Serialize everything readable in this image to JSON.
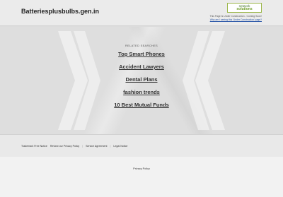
{
  "header": {
    "domain": "Batteriesplusbulbs.gen.in",
    "logo_line1": "network",
    "logo_line2": "solutions",
    "note_line1": "This Page Is Under Construction - Coming Soon!",
    "note_link": "Why am I seeing this 'Under Construction' page?"
  },
  "main": {
    "related_label": "RELATED SEARCHES",
    "links": [
      "Top Smart Phones",
      "Accident Lawyers",
      "Dental Plans",
      "fashion trends",
      "10 Best Mutual Funds"
    ]
  },
  "footer": {
    "links": [
      "Trademark Free Notice",
      "Review our Privacy Policy",
      "Service Agreement",
      "Legal Notice"
    ],
    "separator": "|",
    "bottom_link": "Privacy Policy"
  },
  "colors": {
    "logo_green": "#6f9d2a",
    "note_link": "#2a56a8"
  }
}
